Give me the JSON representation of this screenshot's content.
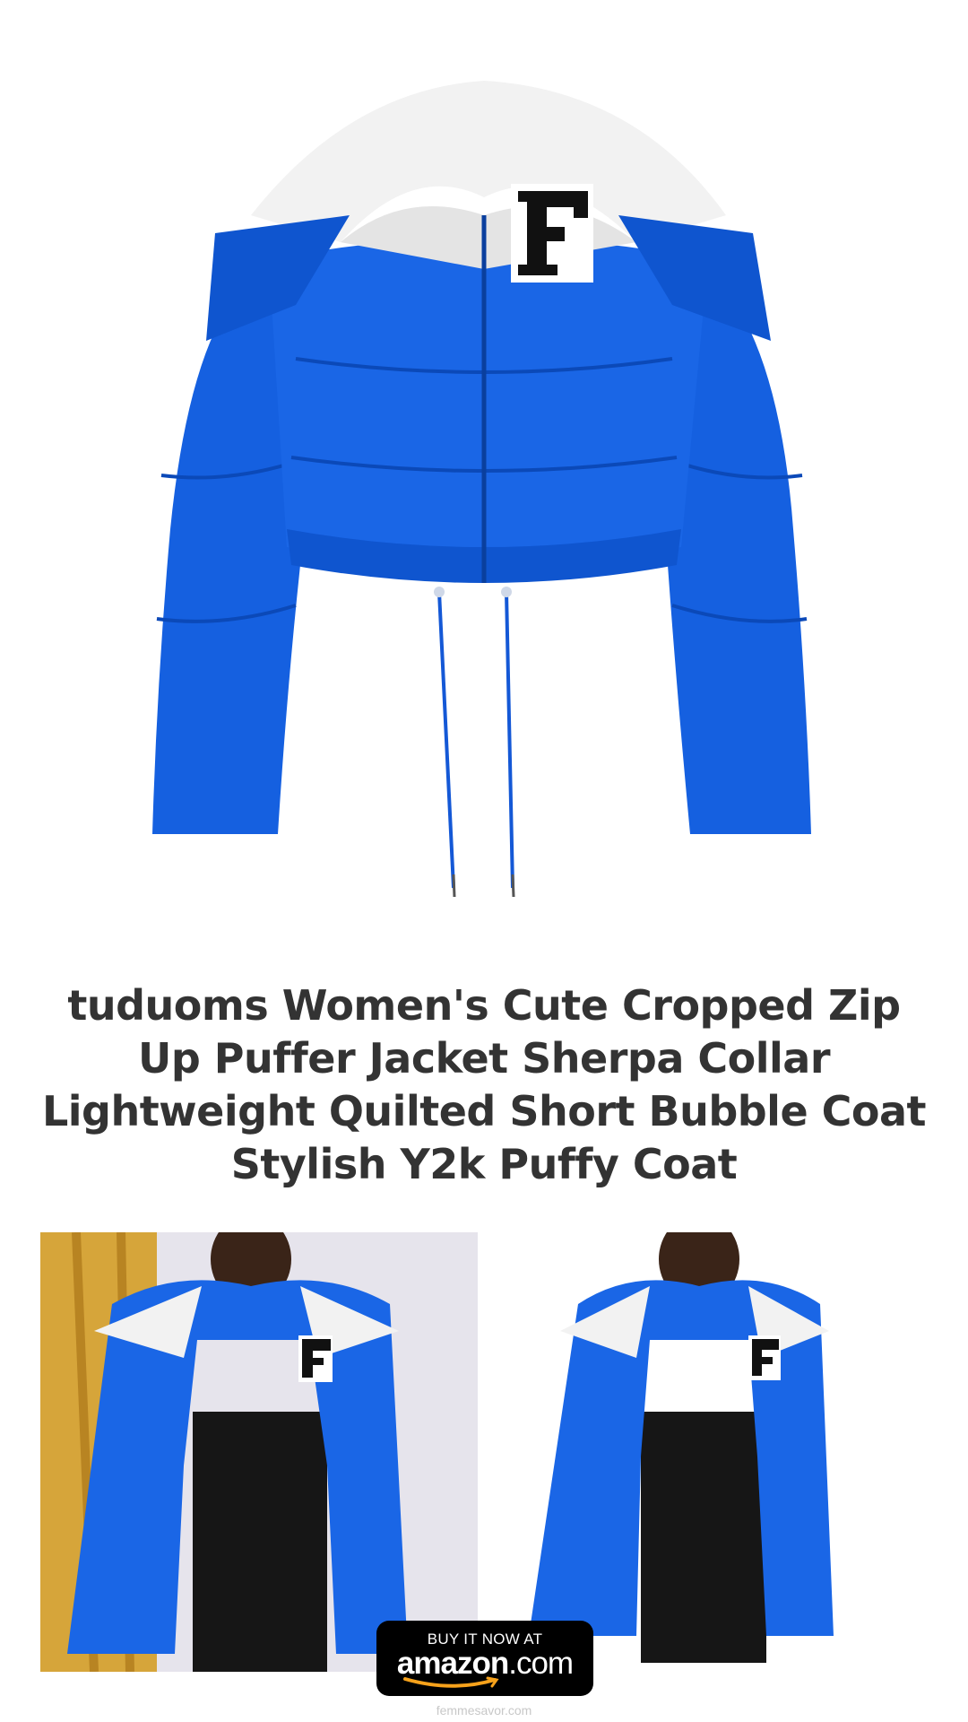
{
  "product": {
    "title": "tuduoms Women's Cute Cropped Zip Up Puffer Jacket Sherpa Collar Lightweight Quilted Short Bubble Coat Stylish Y2k Puffy Coat",
    "patch_letter": "F",
    "jacket_color": "#1560e0",
    "collar_color": "#f2f2f2"
  },
  "buy_button": {
    "top_text": "BUY IT NOW AT",
    "brand_main": "amazon",
    "brand_domain": ".com",
    "smile_color": "#f7a21b"
  },
  "footer": {
    "site": "femmesavor.com"
  },
  "images": {
    "hero_icon": "blue-cropped-puffer-jacket-image",
    "left_photo_icon": "model-wearing-jacket-photo",
    "right_photo_icon": "model-wearing-jacket-cutout-photo"
  }
}
